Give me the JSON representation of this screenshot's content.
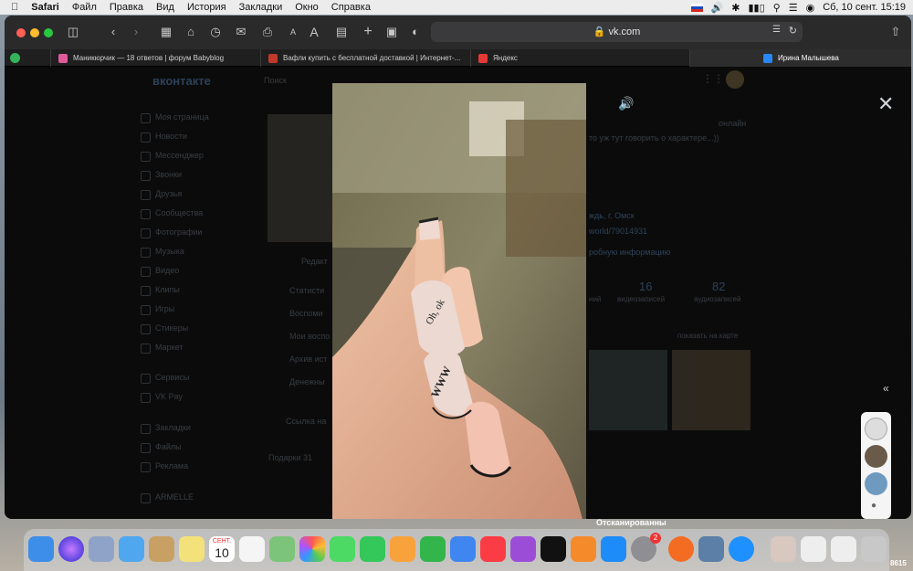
{
  "menubar": {
    "apple": "",
    "app": "Safari",
    "items": [
      "Файл",
      "Правка",
      "Вид",
      "История",
      "Закладки",
      "Окно",
      "Справка"
    ],
    "datetime": "Сб, 10 сент.  15:19"
  },
  "browser": {
    "url": "vk.com",
    "tabs": [
      {
        "label": "Маникюрчик — 18 ответов | форум Babyblog",
        "color": "#e05a9a"
      },
      {
        "label": "Вафли купить с бесплатной доставкой | Интернет-...",
        "color": "#c0392b"
      },
      {
        "label": "Яндекс",
        "color": "#e53935"
      },
      {
        "label": "Ирина Малышева",
        "color": "#2787f5"
      }
    ]
  },
  "vk": {
    "logo": "вконтакте",
    "search": "Поиск",
    "sidebar": [
      "Моя страница",
      "Новости",
      "Мессенджер",
      "Звонки",
      "Друзья",
      "Сообщества",
      "Фотографии",
      "Музыка",
      "Видео",
      "Клипы",
      "Игры",
      "Стикеры",
      "Маркет",
      "Сервисы",
      "VK Pay",
      "Закладки",
      "Файлы",
      "Реклама",
      "ARMELLE"
    ],
    "edit": "Редакт",
    "menu2": [
      "Статисти",
      "Воспоми",
      "Мои воспо",
      "Архив ист",
      "Денежны"
    ],
    "gifts": "Подарки",
    "gifts_count": "31",
    "status": "то уж тут говорить о характере...))",
    "online": "онлайн",
    "city": "ждь, г. Омск",
    "link": "world/79014931",
    "more_info": "робную информацию",
    "stat1": "16",
    "stat1_label": "видеозаписей",
    "stat2": "82",
    "stat2_label": "аудиозаписей",
    "stat0_label": "ний",
    "map": "показать на карте",
    "sendto": "Ссылка на"
  },
  "dock": {
    "calendar_month": "СЕНТ.",
    "calendar_day": "10",
    "note": "Отсканированны",
    "badge": "2"
  },
  "corner_text": "8615"
}
